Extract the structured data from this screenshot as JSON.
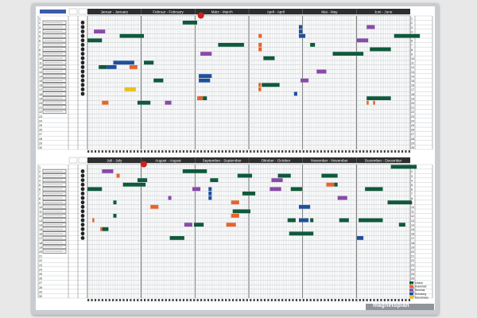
{
  "board": {
    "brand": "magnetoplan",
    "colors": {
      "frame": "#c9ccd0",
      "header_bar": "#2e2e2e",
      "grid_line": "#b9bfc4",
      "dark_green": "#0f5a3c",
      "purple": "#8a4aa8",
      "orange": "#e8642a",
      "blue": "#1e4f9c",
      "yellow": "#e8c21c",
      "red_marker": "#cc1f1f",
      "black_marker": "#222222"
    }
  },
  "top_half": {
    "months": [
      "Januar - January",
      "Februar - February",
      "März - March",
      "April - April",
      "Mai - May",
      "Juni - June"
    ]
  },
  "bottom_half": {
    "months": [
      "Juli - July",
      "August - August",
      "September - September",
      "Oktober - October",
      "November - November",
      "Dezember - December"
    ]
  },
  "row_numbers": [
    "1",
    "2",
    "3",
    "4",
    "5",
    "6",
    "7",
    "8",
    "9",
    "10",
    "11",
    "12",
    "13",
    "14",
    "15",
    "16",
    "17",
    "18",
    "19",
    "20",
    "21",
    "22",
    "23",
    "24",
    "25",
    "26",
    "27",
    "28",
    "29",
    "30"
  ],
  "legend": {
    "items": [
      {
        "label": "Urlaub",
        "color": "#0f5a3c"
      },
      {
        "label": "Krankheit",
        "color": "#e8642a"
      },
      {
        "label": "Seminar",
        "color": "#8a4aa8"
      },
      {
        "label": "Schulung",
        "color": "#1e4f9c"
      },
      {
        "label": "Dienstreise",
        "color": "#e8c21c"
      }
    ]
  },
  "magnets": {
    "top": [
      {
        "row": 3,
        "start": 0.02,
        "len": 0.035,
        "color": "purple"
      },
      {
        "row": 4,
        "start": 0.1,
        "len": 0.075,
        "color": "dark_green"
      },
      {
        "row": 1,
        "start": 0.295,
        "len": 0.045,
        "color": "dark_green"
      },
      {
        "row": 5,
        "start": 0.0,
        "len": 0.045,
        "color": "dark_green"
      },
      {
        "row": 4,
        "start": 0.655,
        "len": 0.02,
        "color": "blue"
      },
      {
        "row": 2,
        "start": 0.655,
        "len": 0.01,
        "color": "blue"
      },
      {
        "row": 3,
        "start": 0.655,
        "len": 0.01,
        "color": "blue"
      },
      {
        "row": 4,
        "start": 0.53,
        "len": 0.01,
        "color": "orange"
      },
      {
        "row": 6,
        "start": 0.53,
        "len": 0.01,
        "color": "orange"
      },
      {
        "row": 7,
        "start": 0.53,
        "len": 0.01,
        "color": "orange"
      },
      {
        "row": 6,
        "start": 0.405,
        "len": 0.08,
        "color": "dark_green"
      },
      {
        "row": 6,
        "start": 0.69,
        "len": 0.015,
        "color": "dark_green"
      },
      {
        "row": 5,
        "start": 0.835,
        "len": 0.035,
        "color": "purple"
      },
      {
        "row": 2,
        "start": 0.865,
        "len": 0.025,
        "color": "purple"
      },
      {
        "row": 4,
        "start": 0.95,
        "len": 0.08,
        "color": "dark_green"
      },
      {
        "row": 7,
        "start": 0.875,
        "len": 0.065,
        "color": "dark_green"
      },
      {
        "row": 8,
        "start": 0.76,
        "len": 0.095,
        "color": "dark_green"
      },
      {
        "row": 8,
        "start": 0.35,
        "len": 0.035,
        "color": "purple"
      },
      {
        "row": 9,
        "start": 0.545,
        "len": 0.035,
        "color": "dark_green"
      },
      {
        "row": 10,
        "start": 0.08,
        "len": 0.065,
        "color": "blue"
      },
      {
        "row": 11,
        "start": 0.06,
        "len": 0.03,
        "color": "blue"
      },
      {
        "row": 10,
        "start": 0.175,
        "len": 0.03,
        "color": "dark_green"
      },
      {
        "row": 11,
        "start": 0.13,
        "len": 0.025,
        "color": "orange"
      },
      {
        "row": 11,
        "start": 0.035,
        "len": 0.025,
        "color": "dark_green"
      },
      {
        "row": 12,
        "start": 0.71,
        "len": 0.03,
        "color": "purple"
      },
      {
        "row": 13,
        "start": 0.345,
        "len": 0.04,
        "color": "blue"
      },
      {
        "row": 14,
        "start": 0.345,
        "len": 0.035,
        "color": "blue"
      },
      {
        "row": 14,
        "start": 0.66,
        "len": 0.025,
        "color": "purple"
      },
      {
        "row": 14,
        "start": 0.205,
        "len": 0.03,
        "color": "dark_green"
      },
      {
        "row": 15,
        "start": 0.54,
        "len": 0.055,
        "color": "dark_green"
      },
      {
        "row": 15,
        "start": 0.53,
        "len": 0.008,
        "color": "orange"
      },
      {
        "row": 16,
        "start": 0.53,
        "len": 0.008,
        "color": "orange"
      },
      {
        "row": 16,
        "start": 0.115,
        "len": 0.035,
        "color": "yellow"
      },
      {
        "row": 17,
        "start": 0.64,
        "len": 0.01,
        "color": "blue"
      },
      {
        "row": 18,
        "start": 0.345,
        "len": 0.025,
        "color": "dark_green"
      },
      {
        "row": 18,
        "start": 0.34,
        "len": 0.018,
        "color": "orange"
      },
      {
        "row": 18,
        "start": 0.865,
        "len": 0.075,
        "color": "dark_green"
      },
      {
        "row": 19,
        "start": 0.045,
        "len": 0.02,
        "color": "orange"
      },
      {
        "row": 19,
        "start": 0.155,
        "len": 0.04,
        "color": "dark_green"
      },
      {
        "row": 19,
        "start": 0.24,
        "len": 0.02,
        "color": "purple"
      },
      {
        "row": 19,
        "start": 0.865,
        "len": 0.006,
        "color": "orange"
      },
      {
        "row": 19,
        "start": 0.885,
        "len": 0.006,
        "color": "orange"
      }
    ],
    "bottom": [
      {
        "row": 0,
        "start": 0.94,
        "len": 0.08,
        "color": "dark_green"
      },
      {
        "row": 1,
        "start": 0.045,
        "len": 0.035,
        "color": "purple"
      },
      {
        "row": 1,
        "start": 0.295,
        "len": 0.075,
        "color": "dark_green"
      },
      {
        "row": 2,
        "start": 0.09,
        "len": 0.01,
        "color": "orange"
      },
      {
        "row": 2,
        "start": 0.465,
        "len": 0.045,
        "color": "dark_green"
      },
      {
        "row": 2,
        "start": 0.59,
        "len": 0.04,
        "color": "dark_green"
      },
      {
        "row": 2,
        "start": 0.725,
        "len": 0.05,
        "color": "dark_green"
      },
      {
        "row": 3,
        "start": 0.155,
        "len": 0.03,
        "color": "dark_green"
      },
      {
        "row": 3,
        "start": 0.38,
        "len": 0.025,
        "color": "dark_green"
      },
      {
        "row": 3,
        "start": 0.57,
        "len": 0.035,
        "color": "purple"
      },
      {
        "row": 4,
        "start": 0.11,
        "len": 0.07,
        "color": "dark_green"
      },
      {
        "row": 4,
        "start": 0.74,
        "len": 0.025,
        "color": "orange"
      },
      {
        "row": 4,
        "start": 0.765,
        "len": 0.01,
        "color": "dark_green"
      },
      {
        "row": 5,
        "start": 0.0,
        "len": 0.045,
        "color": "dark_green"
      },
      {
        "row": 5,
        "start": 0.325,
        "len": 0.025,
        "color": "purple"
      },
      {
        "row": 5,
        "start": 0.375,
        "len": 0.01,
        "color": "blue"
      },
      {
        "row": 5,
        "start": 0.565,
        "len": 0.035,
        "color": "purple"
      },
      {
        "row": 5,
        "start": 0.63,
        "len": 0.035,
        "color": "dark_green"
      },
      {
        "row": 5,
        "start": 0.86,
        "len": 0.055,
        "color": "dark_green"
      },
      {
        "row": 6,
        "start": 0.375,
        "len": 0.01,
        "color": "blue"
      },
      {
        "row": 6,
        "start": 0.48,
        "len": 0.04,
        "color": "dark_green"
      },
      {
        "row": 7,
        "start": 0.375,
        "len": 0.01,
        "color": "blue"
      },
      {
        "row": 7,
        "start": 0.25,
        "len": 0.01,
        "color": "purple"
      },
      {
        "row": 7,
        "start": 0.775,
        "len": 0.03,
        "color": "purple"
      },
      {
        "row": 8,
        "start": 0.08,
        "len": 0.01,
        "color": "dark_green"
      },
      {
        "row": 8,
        "start": 0.445,
        "len": 0.025,
        "color": "orange"
      },
      {
        "row": 8,
        "start": 0.93,
        "len": 0.075,
        "color": "dark_green"
      },
      {
        "row": 9,
        "start": 0.195,
        "len": 0.025,
        "color": "orange"
      },
      {
        "row": 9,
        "start": 0.655,
        "len": 0.035,
        "color": "blue"
      },
      {
        "row": 10,
        "start": 0.45,
        "len": 0.055,
        "color": "dark_green"
      },
      {
        "row": 11,
        "start": 0.445,
        "len": 0.025,
        "color": "orange"
      },
      {
        "row": 11,
        "start": 0.08,
        "len": 0.01,
        "color": "dark_green"
      },
      {
        "row": 12,
        "start": 0.015,
        "len": 0.005,
        "color": "orange"
      },
      {
        "row": 12,
        "start": 0.62,
        "len": 0.025,
        "color": "dark_green"
      },
      {
        "row": 12,
        "start": 0.655,
        "len": 0.03,
        "color": "blue"
      },
      {
        "row": 12,
        "start": 0.84,
        "len": 0.075,
        "color": "dark_green"
      },
      {
        "row": 12,
        "start": 0.69,
        "len": 0.01,
        "color": "dark_green"
      },
      {
        "row": 12,
        "start": 0.78,
        "len": 0.03,
        "color": "dark_green"
      },
      {
        "row": 13,
        "start": 0.3,
        "len": 0.025,
        "color": "purple"
      },
      {
        "row": 13,
        "start": 0.33,
        "len": 0.03,
        "color": "dark_green"
      },
      {
        "row": 13,
        "start": 0.43,
        "len": 0.03,
        "color": "orange"
      },
      {
        "row": 13,
        "start": 0.965,
        "len": 0.02,
        "color": "dark_green"
      },
      {
        "row": 14,
        "start": 0.045,
        "len": 0.02,
        "color": "dark_green"
      },
      {
        "row": 14,
        "start": 0.04,
        "len": 0.006,
        "color": "orange"
      },
      {
        "row": 15,
        "start": 0.625,
        "len": 0.075,
        "color": "dark_green"
      },
      {
        "row": 16,
        "start": 0.255,
        "len": 0.045,
        "color": "dark_green"
      },
      {
        "row": 16,
        "start": 0.835,
        "len": 0.02,
        "color": "blue"
      }
    ],
    "red_pins": [
      {
        "half": "top",
        "x": 0.3515
      },
      {
        "half": "bottom",
        "x": 0.1745
      }
    ]
  }
}
